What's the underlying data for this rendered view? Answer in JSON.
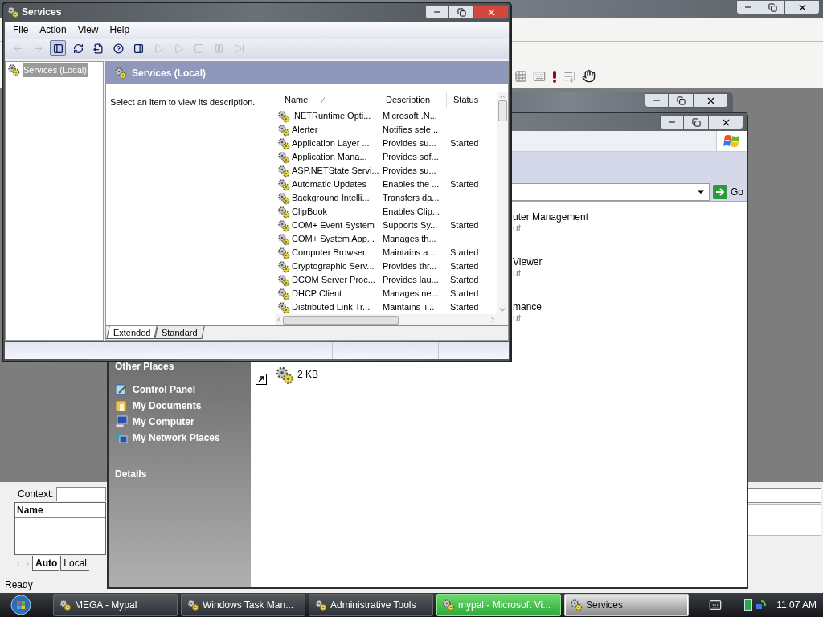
{
  "background_window": {
    "context_label": "Context:",
    "list_header": "Name",
    "tabs": [
      {
        "label": "Auto",
        "selected": true
      },
      {
        "label": "Local",
        "selected": false
      }
    ],
    "status": "Ready"
  },
  "admin_window": {
    "go_label": "Go",
    "tiles": [
      {
        "name": "uter Management",
        "type": "ut"
      },
      {
        "name": "Viewer",
        "type": "ut"
      },
      {
        "name": "mance",
        "type": "ut"
      }
    ],
    "shortcut_size": "2 KB",
    "other_places": {
      "title": "Other Places",
      "items": [
        {
          "kind": "control",
          "label": "Control Panel"
        },
        {
          "kind": "documents",
          "label": "My Documents"
        },
        {
          "kind": "computer",
          "label": "My Computer"
        },
        {
          "kind": "network",
          "label": "My Network Places"
        }
      ]
    },
    "details_title": "Details"
  },
  "services_window": {
    "title": "Services",
    "menu": [
      "File",
      "Action",
      "View",
      "Help"
    ],
    "toolbar": [
      {
        "kind": "back",
        "disabled": true,
        "pressed": false
      },
      {
        "kind": "forward",
        "disabled": true,
        "pressed": false
      },
      {
        "kind": "tree",
        "disabled": false,
        "pressed": true
      },
      {
        "kind": "refresh",
        "disabled": false,
        "pressed": false
      },
      {
        "kind": "export",
        "disabled": false,
        "pressed": false
      },
      {
        "kind": "help",
        "disabled": false,
        "pressed": false
      },
      {
        "kind": "panel",
        "disabled": false,
        "pressed": false
      },
      {
        "kind": "start",
        "disabled": true,
        "pressed": false
      },
      {
        "kind": "start",
        "disabled": true,
        "pressed": false
      },
      {
        "kind": "stop",
        "disabled": true,
        "pressed": false
      },
      {
        "kind": "pause",
        "disabled": true,
        "pressed": false
      },
      {
        "kind": "restart",
        "disabled": true,
        "pressed": false
      }
    ],
    "tree": [
      {
        "label": "Services (Local)",
        "selected": true
      }
    ],
    "header": "Services (Local)",
    "hint": "Select an item to view its description.",
    "columns": [
      "Name",
      "Description",
      "Status"
    ],
    "rows": [
      {
        "name": ".NETRuntime Opti...",
        "description": "Microsoft .N..."
      },
      {
        "name": "Alerter",
        "description": "Notifies sele..."
      },
      {
        "name": "Application Layer ...",
        "description": "Provides su...",
        "status": "Started"
      },
      {
        "name": "Application Mana...",
        "description": "Provides sof..."
      },
      {
        "name": "ASP.NETState Servi...",
        "description": "Provides su..."
      },
      {
        "name": "Automatic Updates",
        "description": "Enables the ...",
        "status": "Started"
      },
      {
        "name": "Background Intelli...",
        "description": "Transfers da..."
      },
      {
        "name": "ClipBook",
        "description": "Enables Clip..."
      },
      {
        "name": "COM+ Event System",
        "description": "Supports Sy...",
        "status": "Started"
      },
      {
        "name": "COM+ System App...",
        "description": "Manages th..."
      },
      {
        "name": "Computer Browser",
        "description": "Maintains a...",
        "status": "Started"
      },
      {
        "name": "Cryptographic Serv...",
        "description": "Provides thr...",
        "status": "Started"
      },
      {
        "name": "DCOM Server Proc...",
        "description": "Provides lau...",
        "status": "Started"
      },
      {
        "name": "DHCP Client",
        "description": "Manages ne...",
        "status": "Started"
      },
      {
        "name": "Distributed Link Tr...",
        "description": "Maintains li...",
        "status": "Started"
      }
    ],
    "tabs": [
      {
        "label": "Extended",
        "selected": true
      },
      {
        "label": "Standard",
        "selected": false
      }
    ]
  },
  "taskbar": {
    "buttons": [
      {
        "label": "MEGA - Mypal",
        "selected": false,
        "flashing": false
      },
      {
        "label": "Windows Task Man...",
        "selected": false,
        "flashing": false
      },
      {
        "label": "Administrative Tools",
        "selected": false,
        "flashing": false
      },
      {
        "label": "mypal - Microsoft Vi...",
        "selected": false,
        "flashing": true
      },
      {
        "label": "Services",
        "selected": true,
        "flashing": false
      }
    ],
    "clock": "11:07 AM"
  }
}
